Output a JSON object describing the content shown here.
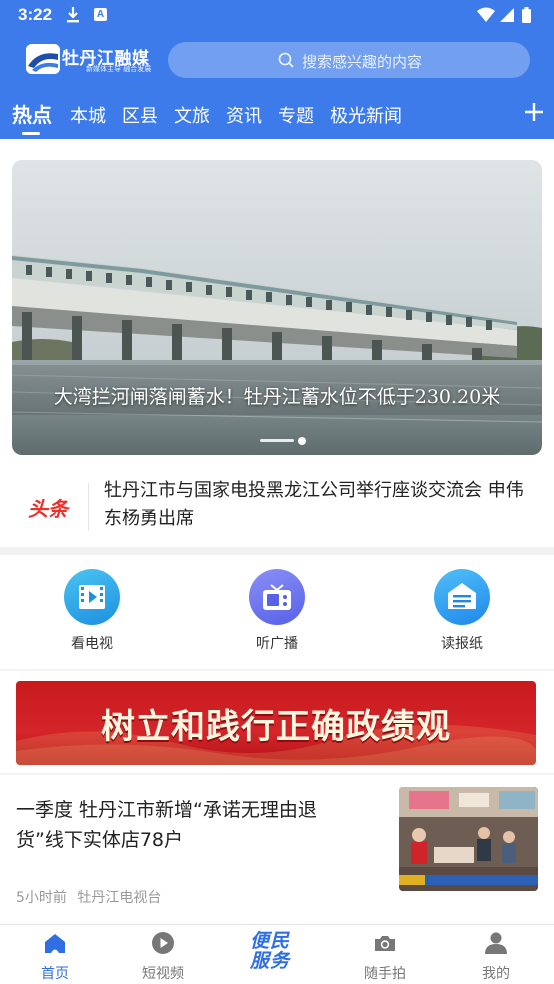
{
  "status_bar": {
    "time": "3:22",
    "a_icon": "A"
  },
  "brand": {
    "name": "牡丹江融媒",
    "slogan": "新媒体主导 融合发展"
  },
  "search": {
    "placeholder": "搜索感兴趣的内容"
  },
  "tabs": [
    {
      "label": "热点",
      "active": true
    },
    {
      "label": "本城"
    },
    {
      "label": "区县"
    },
    {
      "label": "文旅"
    },
    {
      "label": "资讯"
    },
    {
      "label": "专题"
    },
    {
      "label": "极光新闻"
    }
  ],
  "carousel": {
    "caption": "大湾拦河闸落闸蓄水！牡丹江蓄水位不低于230.20米",
    "total_slides": 2,
    "current_slide": 2
  },
  "headline": {
    "tag": "头条",
    "text": "牡丹江市与国家电投黑龙江公司举行座谈交流会 申伟东杨勇出席"
  },
  "quick_links": [
    {
      "label": "看电视",
      "icon": "tv-video-icon"
    },
    {
      "label": "听广播",
      "icon": "radio-icon"
    },
    {
      "label": "读报纸",
      "icon": "newspaper-icon"
    }
  ],
  "promo": {
    "text": "树立和践行正确政绩观"
  },
  "news": {
    "title": "一季度 牡丹江市新增“承诺无理由退货”线下实体店78户",
    "time": "5小时前",
    "source": "牡丹江电视台"
  },
  "bottom_nav": {
    "home": "首页",
    "short_video": "短视频",
    "service_line1": "便民",
    "service_line2": "服务",
    "snapshot": "随手拍",
    "mine": "我的"
  },
  "colors": {
    "header_blue": "#3d7bea",
    "headline_red": "#e8322b",
    "nav_active": "#2f6fe3"
  }
}
